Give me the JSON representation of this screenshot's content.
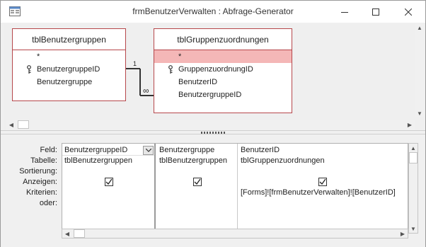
{
  "window": {
    "title": "frmBenutzerVerwalten : Abfrage-Generator"
  },
  "tables": [
    {
      "name": "tblBenutzergruppen",
      "fields": [
        {
          "label": "*",
          "key": false
        },
        {
          "label": "BenutzergruppeID",
          "key": true
        },
        {
          "label": "Benutzergruppe",
          "key": false
        }
      ]
    },
    {
      "name": "tblGruppenzuordnungen",
      "fields": [
        {
          "label": "*",
          "key": false,
          "selected": true
        },
        {
          "label": "GruppenzuordnungID",
          "key": true
        },
        {
          "label": "BenutzerID",
          "key": false
        },
        {
          "label": "BenutzergruppeID",
          "key": false
        }
      ]
    }
  ],
  "relationship": {
    "one_label": "1",
    "many_label": "∞"
  },
  "grid": {
    "row_labels": [
      "Feld:",
      "Tabelle:",
      "Sortierung:",
      "Anzeigen:",
      "Kriterien:",
      "oder:"
    ],
    "columns": [
      {
        "feld": "BenutzergruppeID",
        "tabelle": "tblBenutzergruppen",
        "sortierung": "",
        "anzeigen": true,
        "kriterien": "",
        "oder": ""
      },
      {
        "feld": "Benutzergruppe",
        "tabelle": "tblBenutzergruppen",
        "sortierung": "",
        "anzeigen": true,
        "kriterien": "",
        "oder": ""
      },
      {
        "feld": "BenutzerID",
        "tabelle": "tblGruppenzuordnungen",
        "sortierung": "",
        "anzeigen": true,
        "kriterien": "[Forms]![frmBenutzerVerwalten]![BenutzerID]",
        "oder": ""
      }
    ]
  },
  "colors": {
    "table_border": "#b6474b",
    "selected_field": "#f4b7b7"
  }
}
